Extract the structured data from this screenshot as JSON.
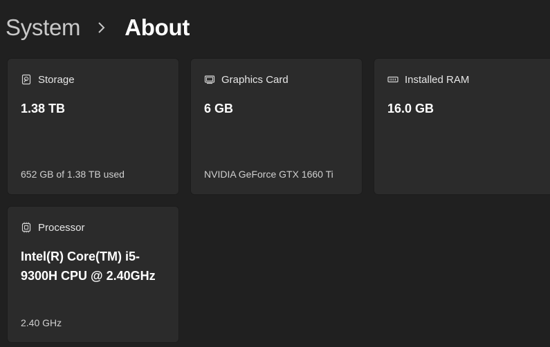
{
  "breadcrumb": {
    "parent": "System",
    "current": "About"
  },
  "cards": {
    "storage": {
      "icon": "storage-icon",
      "title": "Storage",
      "value": "1.38 TB",
      "sub": "652 GB of 1.38 TB used"
    },
    "graphics": {
      "icon": "graphics-card-icon",
      "title": "Graphics Card",
      "value": "6 GB",
      "sub": "NVIDIA GeForce GTX 1660 Ti"
    },
    "ram": {
      "icon": "ram-icon",
      "title": "Installed RAM",
      "value": "16.0 GB"
    },
    "processor": {
      "icon": "processor-icon",
      "title": "Processor",
      "value": "Intel(R) Core(TM) i5-9300H CPU @ 2.40GHz",
      "sub": "2.40 GHz"
    }
  }
}
